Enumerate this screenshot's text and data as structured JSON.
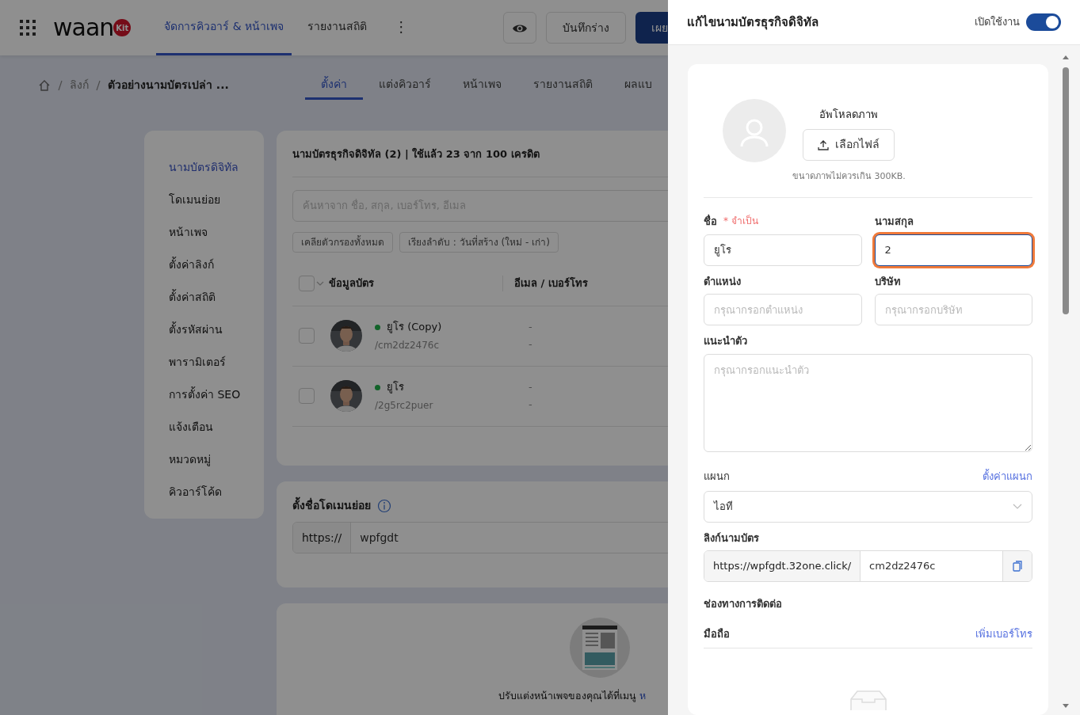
{
  "topbar": {
    "logo_text": "waan",
    "logo_badge": "Kit",
    "nav": [
      {
        "label": "จัดการคิวอาร์ & หน้าเพจ",
        "selected": true
      },
      {
        "label": "รายงานสถิติ",
        "selected": false
      }
    ],
    "more": "⋮",
    "draft_button": "บันทึกร่าง",
    "publish_button": "เผย"
  },
  "breadcrumb": [
    "ลิงก์",
    "ตัวอย่างนามบัตรเปล่า ..."
  ],
  "subtabs": [
    {
      "label": "ตั้งค่า",
      "selected": true
    },
    {
      "label": "แต่งคิวอาร์",
      "selected": false
    },
    {
      "label": "หน้าเพจ",
      "selected": false
    },
    {
      "label": "รายงานสถิติ",
      "selected": false
    },
    {
      "label": "ผลแบ",
      "selected": false
    }
  ],
  "sidebar": {
    "items": [
      {
        "label": "นามบัตรดิจิทัล",
        "selected": true
      },
      {
        "label": "โดเมนย่อย",
        "selected": false
      },
      {
        "label": "หน้าเพจ",
        "selected": false
      },
      {
        "label": "ตั้งค่าลิงก์",
        "selected": false
      },
      {
        "label": "ตั้งค่าสถิติ",
        "selected": false
      },
      {
        "label": "ตั้งรหัสผ่าน",
        "selected": false
      },
      {
        "label": "พารามิเตอร์",
        "selected": false
      },
      {
        "label": "การตั้งค่า SEO",
        "selected": false
      },
      {
        "label": "แจ้งเตือน",
        "selected": false
      },
      {
        "label": "หมวดหมู่",
        "selected": false
      },
      {
        "label": "คิวอาร์โค้ด",
        "selected": false
      }
    ]
  },
  "cards_panel": {
    "title": "นามบัตรธุรกิจดิจิทัล (2) | ใช้แล้ว 23 จาก 100 เครดิต",
    "search_placeholder": "ค้นหาจาก ชื่อ, สกุล, เบอร์โทร, อีเมล",
    "filters": [
      "เคลียตัวกรองทั้งหมด",
      "เรียงลำดับ : วันที่สร้าง (ใหม่ - เก่า)"
    ],
    "columns": [
      "ข้อมูลบัตร",
      "อีเมล / เบอร์โทร"
    ],
    "select_all_checked": false,
    "rows": [
      {
        "name": "ยูโร (Copy)",
        "slug": "/cm2dz2476c",
        "contact": [
          "-",
          "-"
        ],
        "checked": false,
        "active": true
      },
      {
        "name": "ยูโร",
        "slug": "/2g5rc2puer",
        "contact": [
          "-",
          "-"
        ],
        "checked": false,
        "active": true
      }
    ]
  },
  "subdomain": {
    "title": "ตั้งชื่อโดเมนย่อย",
    "prefix": "https://",
    "value": "wpfgdt"
  },
  "page_hint": {
    "text": "ปรับแต่งหน้าเพจของคุณได้ที่เมนู",
    "link": "ห"
  },
  "drawer": {
    "title": "แก้ไขนามบัตรธุรกิจดิจิทัล",
    "toggle_label": "เปิดใช้งาน",
    "enabled": true,
    "upload_title": "อัพโหลดภาพ",
    "upload_button": "เลือกไฟล์",
    "upload_hint": "ขนาดภาพไม่ควรเกิน 300KB.",
    "first_name": {
      "label": "ชื่อ",
      "required": "* จำเป็น",
      "value": "ยูโร"
    },
    "last_name": {
      "label": "นามสกุล",
      "value": "2",
      "focused": true
    },
    "position": {
      "label": "ตำแหน่ง",
      "placeholder": "กรุณากรอกตำแหน่ง"
    },
    "company": {
      "label": "บริษัท",
      "placeholder": "กรุณากรอกบริษัท"
    },
    "intro": {
      "label": "แนะนำตัว",
      "placeholder": "กรุณากรอกแนะนำตัว"
    },
    "department": {
      "label": "แผนก",
      "link": "ตั้งค่าแผนก",
      "value": "ไอที"
    },
    "card_link": {
      "label": "ลิงก์นามบัตร",
      "prefix": "https://wpfgdt.32one.click/",
      "value": "cm2dz2476c"
    },
    "contact": {
      "title": "ช่องทางการติดต่อ",
      "mobile_label": "มือถือ",
      "add_link": "เพิ่มเบอร์โทร"
    }
  }
}
